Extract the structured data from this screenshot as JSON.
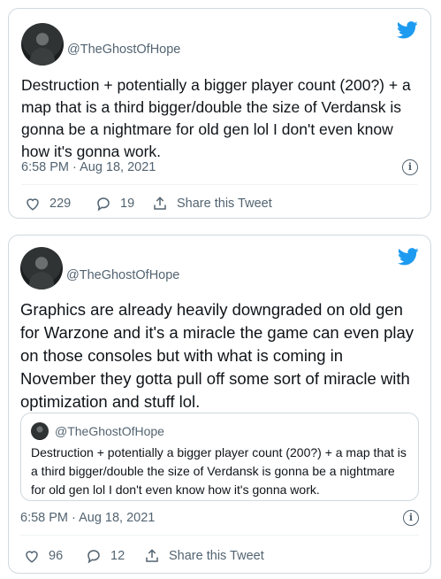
{
  "tweets": [
    {
      "handle": "@TheGhostOfHope",
      "text": "Destruction + potentially a bigger player count (200?) + a map that is a third bigger/double the size of Verdansk is gonna be a nightmare for old gen lol I don't even know how it's gonna work.",
      "timestamp": "6:58 PM · Aug 18, 2021",
      "likes": "229",
      "replies": "19",
      "share_label": "Share this Tweet"
    },
    {
      "handle": "@TheGhostOfHope",
      "text": "Graphics are already heavily downgraded on old gen for Warzone and it's a miracle the game can even play on those consoles but with what is coming in November they gotta pull off some sort of miracle with optimization and stuff lol.",
      "quote": {
        "handle": "@TheGhostOfHope",
        "text": "Destruction + potentially a bigger player count (200?) + a map that is a third bigger/double the size of Verdansk is gonna be a nightmare for old gen lol I don't even know how it's gonna work."
      },
      "timestamp": "6:58 PM · Aug 18, 2021",
      "likes": "96",
      "replies": "12",
      "share_label": "Share this Tweet"
    }
  ],
  "info_glyph": "i",
  "colors": {
    "brand": "#1d9bf0",
    "text": "#0f1419",
    "muted": "#536471",
    "border": "#cfd9de"
  },
  "icons": [
    "twitter-bird-icon",
    "info-icon",
    "heart-icon",
    "reply-icon",
    "share-icon"
  ]
}
